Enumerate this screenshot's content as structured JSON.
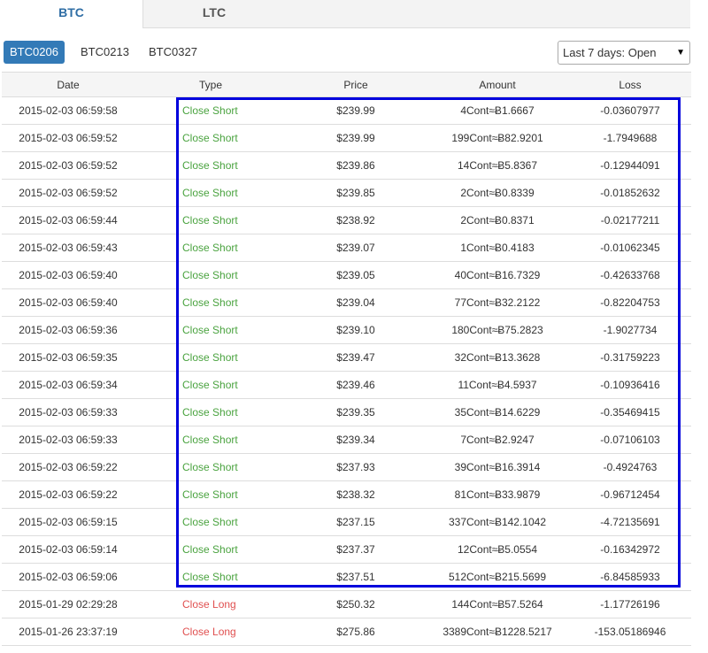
{
  "tabs": [
    {
      "label": "BTC",
      "active": true
    },
    {
      "label": "LTC",
      "active": false
    }
  ],
  "contracts": [
    {
      "label": "BTC0206",
      "active": true
    },
    {
      "label": "BTC0213",
      "active": false
    },
    {
      "label": "BTC0327",
      "active": false
    }
  ],
  "filter": {
    "selected": "Last 7 days: Open"
  },
  "table": {
    "headers": [
      "Date",
      "Type",
      "Price",
      "Amount",
      "Loss"
    ],
    "rows": [
      [
        "2015-02-03 06:59:58",
        "Close Short",
        "$239.99",
        "4Cont≈Ƀ1.6667",
        "-0.03607977"
      ],
      [
        "2015-02-03 06:59:52",
        "Close Short",
        "$239.99",
        "199Cont≈Ƀ82.9201",
        "-1.7949688"
      ],
      [
        "2015-02-03 06:59:52",
        "Close Short",
        "$239.86",
        "14Cont≈Ƀ5.8367",
        "-0.12944091"
      ],
      [
        "2015-02-03 06:59:52",
        "Close Short",
        "$239.85",
        "2Cont≈Ƀ0.8339",
        "-0.01852632"
      ],
      [
        "2015-02-03 06:59:44",
        "Close Short",
        "$238.92",
        "2Cont≈Ƀ0.8371",
        "-0.02177211"
      ],
      [
        "2015-02-03 06:59:43",
        "Close Short",
        "$239.07",
        "1Cont≈Ƀ0.4183",
        "-0.01062345"
      ],
      [
        "2015-02-03 06:59:40",
        "Close Short",
        "$239.05",
        "40Cont≈Ƀ16.7329",
        "-0.42633768"
      ],
      [
        "2015-02-03 06:59:40",
        "Close Short",
        "$239.04",
        "77Cont≈Ƀ32.2122",
        "-0.82204753"
      ],
      [
        "2015-02-03 06:59:36",
        "Close Short",
        "$239.10",
        "180Cont≈Ƀ75.2823",
        "-1.9027734"
      ],
      [
        "2015-02-03 06:59:35",
        "Close Short",
        "$239.47",
        "32Cont≈Ƀ13.3628",
        "-0.31759223"
      ],
      [
        "2015-02-03 06:59:34",
        "Close Short",
        "$239.46",
        "11Cont≈Ƀ4.5937",
        "-0.10936416"
      ],
      [
        "2015-02-03 06:59:33",
        "Close Short",
        "$239.35",
        "35Cont≈Ƀ14.6229",
        "-0.35469415"
      ],
      [
        "2015-02-03 06:59:33",
        "Close Short",
        "$239.34",
        "7Cont≈Ƀ2.9247",
        "-0.07106103"
      ],
      [
        "2015-02-03 06:59:22",
        "Close Short",
        "$237.93",
        "39Cont≈Ƀ16.3914",
        "-0.4924763"
      ],
      [
        "2015-02-03 06:59:22",
        "Close Short",
        "$238.32",
        "81Cont≈Ƀ33.9879",
        "-0.96712454"
      ],
      [
        "2015-02-03 06:59:15",
        "Close Short",
        "$237.15",
        "337Cont≈Ƀ142.1042",
        "-4.72135691"
      ],
      [
        "2015-02-03 06:59:14",
        "Close Short",
        "$237.37",
        "12Cont≈Ƀ5.0554",
        "-0.16342972"
      ],
      [
        "2015-02-03 06:59:06",
        "Close Short",
        "$237.51",
        "512Cont≈Ƀ215.5699",
        "-6.84585933"
      ],
      [
        "2015-01-29 02:29:28",
        "Close Long",
        "$250.32",
        "144Cont≈Ƀ57.5264",
        "-1.17726196"
      ],
      [
        "2015-01-26 23:37:19",
        "Close Long",
        "$275.86",
        "3389Cont≈Ƀ1228.5217",
        "-153.05186946"
      ]
    ]
  },
  "colors": {
    "accent": "#337ab7",
    "tab_active_text": "#2e6da4",
    "close_short": "#4aa33f",
    "close_long": "#e05050",
    "highlight_box": "#0000dd"
  },
  "icons": {
    "select_arrow": "caret-down-icon"
  }
}
